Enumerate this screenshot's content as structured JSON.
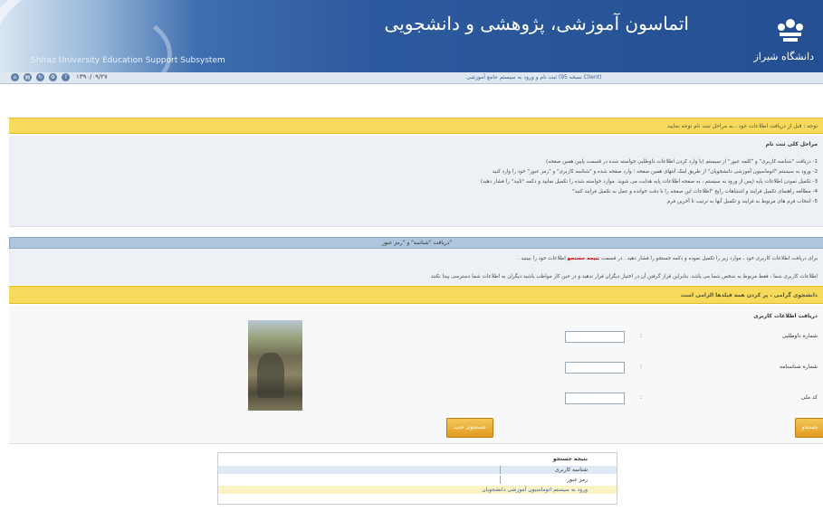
{
  "header": {
    "subtitle": "Shiraz University Education Support Subsystem",
    "persian_title": "اتماسون آموزشی، پژوهشی و دانشجویی",
    "logo_caption": "دانشگاه شیراز"
  },
  "toolbar": {
    "date": "۱۳۹۰/۰۹/۲۷",
    "link": "ثبت نام و ورود به سیستم جامع آموزشی (نسخه 95 Client)"
  },
  "notice": {
    "bar_text": "توجه : قبل از دریافت اطلاعات خود ، به مراحل ثبت نام توجه نمایید",
    "heading": "مراحل کلی ثبت نام",
    "steps": [
      "1- دریافت \"شناسه کاربری\" و \"کلمه عبور\" از سیستم (با وارد کردن اطلاعات داوطلبی خواسته شده در قسمت پایین همین صفحه)",
      "2- ورود به سیستم \"اتوماسیون آموزشی دانشجویان\" از طریق لینک انتهای همین صفحه ؛ وارد صفحه شده و \"شناسه کاربری\" و \"رمز عبور\" خود را وارد کنید",
      "3- تکمیل نمودن اطلاعات پایه (پس از ورود به سیستم ، به صفحه اطلاعات پایه هدایت می شوید. موارد خواسته شده را تکمیل نمایید و دکمه \"تایید\" را فشار دهید)",
      "4- مطالعه راهنمای تکمیل فرایند و اشتباهات رایج \"اطلاعات این صفحه را با دقت خوانده و عمل به تکمیل فرایند کنید\"",
      "5- انتخاب فرم های مربوط به فرایند و تکمیل آنها به ترتیب تا آخرین فرم"
    ]
  },
  "registration": {
    "title": "دریافت \"شناسه\" و \"رمز عبور\"",
    "info_line1_pre": "برای دریافت اطلاعات کاربری خود ، موارد زیر را تکمیل نموده و دکمه جستجو را فشار دهید . در قسمت",
    "info_line1_highlight": "نتیجه جستجو",
    "info_line1_post": "اطلاعات خود را ببینید .",
    "info_line2": "اطلاعات کاربری شما ، فقط مربوط به شخص شما می باشد. بنابراین قرار گرفتن آن در اختیار دیگران قرار ندهید و در حین کار مواظب باشید دیگران به اطلاعات شما دسترسی پیدا نکنند",
    "welcome": "دانشجوی گرامی ، پر کردن همه فیلدها الزامی است"
  },
  "form": {
    "heading": "دریافت اطلاعات کاربری",
    "field1_label": "شماره داوطلبی",
    "field2_label": "شماره شناسنامه",
    "field3_label": "کد ملی",
    "search_button": "جستجو",
    "new_search_button": "جستجوی جدید"
  },
  "results": {
    "title": "نتیجه جستجو",
    "row1": "شناسه کاربری",
    "row2": "رمز عبور",
    "link": "ورود به سیستم اتوماسیون آموزشی دانشجویان"
  },
  "colors": {
    "header_blue": "#244f92",
    "notice_yellow": "#f7d95c",
    "button_orange": "#e29a1f",
    "highlight_red": "#cc0000"
  }
}
